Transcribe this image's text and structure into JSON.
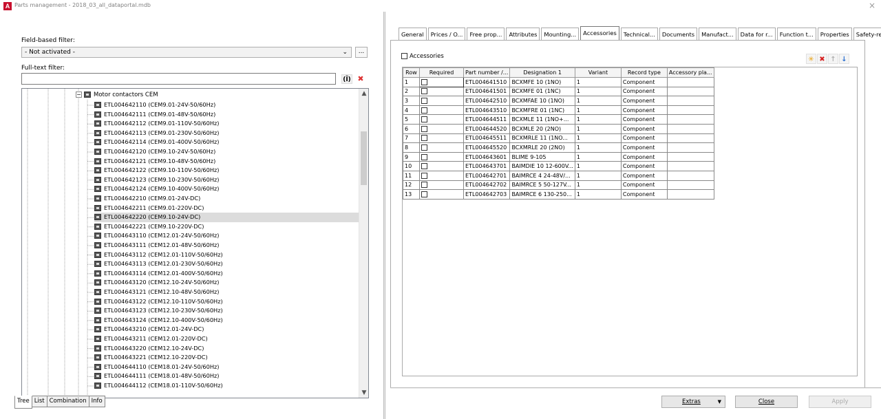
{
  "window": {
    "title": "Parts management - 2018_03_all_dataportal.mdb",
    "close_glyph": "×",
    "icon_text": "A"
  },
  "filter": {
    "field_based_label": "Field-based filter:",
    "field_based_value": "- Not activated -",
    "more_btn": "...",
    "full_text_label": "Full-text filter:",
    "full_text_value": "",
    "search_btn": "(Ĩ)",
    "clear_btn": "✖"
  },
  "tree": {
    "root": {
      "expander": "⊟",
      "label": "Motor contactors CEM"
    },
    "items": [
      "ETL004642110 (CEM9.01-24V-50/60Hz)",
      "ETL004642111 (CEM9.01-48V-50/60Hz)",
      "ETL004642112 (CEM9.01-110V-50/60Hz)",
      "ETL004642113 (CEM9.01-230V-50/60Hz)",
      "ETL004642114 (CEM9.01-400V-50/60Hz)",
      "ETL004642120 (CEM9.10-24V-50/60Hz)",
      "ETL004642121 (CEM9.10-48V-50/60Hz)",
      "ETL004642122 (CEM9.10-110V-50/60Hz)",
      "ETL004642123 (CEM9.10-230V-50/60Hz)",
      "ETL004642124 (CEM9.10-400V-50/60Hz)",
      "ETL004642210 (CEM9.01-24V-DC)",
      "ETL004642211 (CEM9.01-220V-DC)",
      "ETL004642220 (CEM9.10-24V-DC)",
      "ETL004642221 (CEM9.10-220V-DC)",
      "ETL004643110 (CEM12.01-24V-50/60Hz)",
      "ETL004643111 (CEM12.01-48V-50/60Hz)",
      "ETL004643112 (CEM12.01-110V-50/60Hz)",
      "ETL004643113 (CEM12.01-230V-50/60Hz)",
      "ETL004643114 (CEM12.01-400V-50/60Hz)",
      "ETL004643120 (CEM12.10-24V-50/60Hz)",
      "ETL004643121 (CEM12.10-48V-50/60Hz)",
      "ETL004643122 (CEM12.10-110V-50/60Hz)",
      "ETL004643123 (CEM12.10-230V-50/60Hz)",
      "ETL004643124 (CEM12.10-400V-50/60Hz)",
      "ETL004643210 (CEM12.01-24V-DC)",
      "ETL004643211 (CEM12.01-220V-DC)",
      "ETL004643220 (CEM12.10-24V-DC)",
      "ETL004643221 (CEM12.10-220V-DC)",
      "ETL004644110 (CEM18.01-24V-50/60Hz)",
      "ETL004644111 (CEM18.01-48V-50/60Hz)",
      "ETL004644112 (CEM18.01-110V-50/60Hz)"
    ],
    "selected_index": 12,
    "scroll_up": "▲",
    "scroll_down": "▼"
  },
  "left_tabs": [
    {
      "label": "Tree",
      "active": true
    },
    {
      "label": "List",
      "active": false
    },
    {
      "label": "Combination",
      "active": false
    },
    {
      "label": "Info",
      "active": false
    }
  ],
  "right_tabs": [
    {
      "label": "General",
      "active": false
    },
    {
      "label": "Prices / O...",
      "active": false
    },
    {
      "label": "Free prop...",
      "active": false
    },
    {
      "label": "Attributes",
      "active": false
    },
    {
      "label": "Mounting...",
      "active": false
    },
    {
      "label": "Accessories",
      "active": true
    },
    {
      "label": "Technical...",
      "active": false
    },
    {
      "label": "Documents",
      "active": false
    },
    {
      "label": "Manufact...",
      "active": false
    },
    {
      "label": "Data for r...",
      "active": false
    },
    {
      "label": "Function t...",
      "active": false
    },
    {
      "label": "Properties",
      "active": false
    },
    {
      "label": "Safety-rel...",
      "active": false
    }
  ],
  "accessories": {
    "checkbox_label": "Accessories",
    "checked": false,
    "toolbar": [
      {
        "name": "new-row-icon",
        "glyph": "✳",
        "color": "#e8a317"
      },
      {
        "name": "delete-row-icon",
        "glyph": "✖",
        "color": "#d62020"
      },
      {
        "name": "move-up-icon",
        "glyph": "↑",
        "color": "#b0b0b0"
      },
      {
        "name": "move-down-icon",
        "glyph": "↓",
        "color": "#2a6fd0"
      }
    ],
    "columns": [
      "Row",
      "Required",
      "Part number /...",
      "Designation 1",
      "Variant",
      "Record type",
      "Accessory pla..."
    ],
    "rows": [
      {
        "row": "1",
        "required": false,
        "part": "ETL004641510",
        "designation": "BCXMFE 10 (1NO)",
        "variant": "1",
        "record_type": "Component",
        "accessory": ""
      },
      {
        "row": "2",
        "required": false,
        "part": "ETL004641501",
        "designation": "BCXMFE 01 (1NC)",
        "variant": "1",
        "record_type": "Component",
        "accessory": ""
      },
      {
        "row": "3",
        "required": false,
        "part": "ETL004642510",
        "designation": "BCXMFAE 10 (1NO)",
        "variant": "1",
        "record_type": "Component",
        "accessory": ""
      },
      {
        "row": "4",
        "required": false,
        "part": "ETL004643510",
        "designation": "BCXMFRE 01 (1NC)",
        "variant": "1",
        "record_type": "Component",
        "accessory": ""
      },
      {
        "row": "5",
        "required": false,
        "part": "ETL004644511",
        "designation": "BCXMLE 11 (1NO+...",
        "variant": "1",
        "record_type": "Component",
        "accessory": ""
      },
      {
        "row": "6",
        "required": false,
        "part": "ETL004644520",
        "designation": "BCXMLE 20 (2NO)",
        "variant": "1",
        "record_type": "Component",
        "accessory": ""
      },
      {
        "row": "7",
        "required": false,
        "part": "ETL004645511",
        "designation": "BCXMRLE 11 (1NO...",
        "variant": "1",
        "record_type": "Component",
        "accessory": ""
      },
      {
        "row": "8",
        "required": false,
        "part": "ETL004645520",
        "designation": "BCXMRLE 20 (2NO)",
        "variant": "1",
        "record_type": "Component",
        "accessory": ""
      },
      {
        "row": "9",
        "required": false,
        "part": "ETL004643601",
        "designation": "BLIME 9-105",
        "variant": "1",
        "record_type": "Component",
        "accessory": ""
      },
      {
        "row": "10",
        "required": false,
        "part": "ETL004643701",
        "designation": "BAIMDIE 10 12-600V...",
        "variant": "1",
        "record_type": "Component",
        "accessory": ""
      },
      {
        "row": "11",
        "required": false,
        "part": "ETL004642701",
        "designation": "BAIMRCE 4 24-48V/...",
        "variant": "1",
        "record_type": "Component",
        "accessory": ""
      },
      {
        "row": "12",
        "required": false,
        "part": "ETL004642702",
        "designation": "BAIMRCE 5 50-127V...",
        "variant": "1",
        "record_type": "Component",
        "accessory": ""
      },
      {
        "row": "13",
        "required": false,
        "part": "ETL004642703",
        "designation": "BAIMRCE 6 130-250...",
        "variant": "1",
        "record_type": "Component",
        "accessory": ""
      }
    ]
  },
  "buttons": {
    "extras": "Extras",
    "extras_arrow": "▼",
    "close": "Close",
    "apply": "Apply"
  }
}
